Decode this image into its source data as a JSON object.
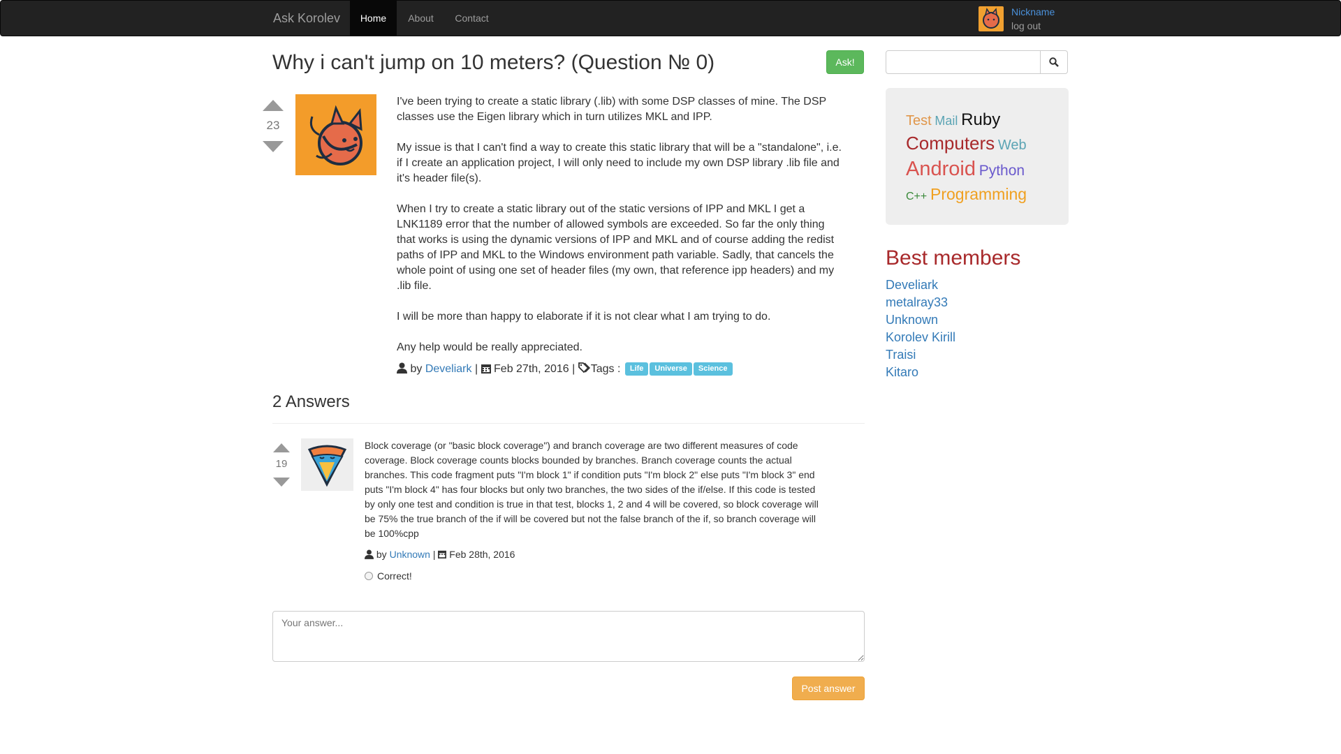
{
  "navbar": {
    "brand": "Ask Korolev",
    "items": [
      {
        "label": "Home",
        "active": true
      },
      {
        "label": "About",
        "active": false
      },
      {
        "label": "Contact",
        "active": false
      }
    ],
    "user": {
      "nickname": "Nickname",
      "logout": "log out"
    }
  },
  "question": {
    "title": "Why i can't jump on 10 meters? (Question № 0)",
    "ask_label": "Ask!",
    "votes": "23",
    "paragraphs": [
      "I've been trying to create a static library (.lib) with some DSP classes of mine. The DSP classes use the Eigen library which in turn utilizes MKL and IPP.",
      "My issue is that I can't find a way to create this static library that will be a \"standalone\", i.e. if I create an application project, I will only need to include my own DSP library .lib file and it's header file(s).",
      "When I try to create a static library out of the static versions of IPP and MKL I get a LNK1189 error that the number of allowed symbols are exceeded. So far the only thing that works is using the dynamic versions of IPP and MKL and of course adding the redist paths of IPP and MKL to the Windows environment path variable. Sadly, that cancels the whole point of using one set of header files (my own, that reference ipp headers) and my .lib file.",
      "I will be more than happy to elaborate if it is not clear what I am trying to do.",
      "Any help would be really appreciated."
    ],
    "by_label": "by",
    "author": "Develiark",
    "sep1": "|",
    "date": "Feb 27th, 2016",
    "sep2": "|",
    "tags_label": "Tags :",
    "tags": [
      "Life",
      "Universe",
      "Science"
    ]
  },
  "answers": {
    "heading": "2 Answers",
    "items": [
      {
        "votes": "19",
        "text": "Block coverage (or \"basic block coverage\") and branch coverage are two different measures of code coverage. Block coverage counts blocks bounded by branches. Branch coverage counts the actual branches. This code fragment puts \"I'm block 1\" if condition puts \"I'm block 2\" else puts \"I'm block 3\" end puts \"I'm block 4\" has four blocks but only two branches, the two sides of the if/else. If this code is tested by only one test and condition is true in that test, blocks 1, 2 and 4 will be covered, so block coverage will be 75% the true branch of the if will be covered but not the false branch of the if, so branch coverage will be 100%cpp",
        "by_label": "by",
        "author": "Unknown",
        "sep": "|",
        "date": "Feb 28th, 2016",
        "correct_label": "Correct!"
      }
    ]
  },
  "answer_form": {
    "placeholder": "Your answer...",
    "submit_label": "Post answer"
  },
  "sidebar": {
    "search_placeholder": "",
    "tag_cloud": [
      {
        "label": "Test",
        "color": "#e0964a"
      },
      {
        "label": "Mail",
        "color": "#5ba4b4"
      },
      {
        "label": "Ruby",
        "color": "#111111"
      },
      {
        "label": "Computers",
        "color": "#a8292b"
      },
      {
        "label": "Web",
        "color": "#5ba4b4"
      },
      {
        "label": "Android",
        "color": "#d9534f"
      },
      {
        "label": "Python",
        "color": "#6a5acd"
      },
      {
        "label": "C++",
        "color": "#3a8a3a"
      },
      {
        "label": "Programming",
        "color": "#f0a020"
      }
    ],
    "best_members_title": "Best members",
    "members": [
      "Develiark",
      "metalray33",
      "Unknown",
      "Korolev Kirill",
      "Traisi",
      "Kitaro"
    ]
  }
}
